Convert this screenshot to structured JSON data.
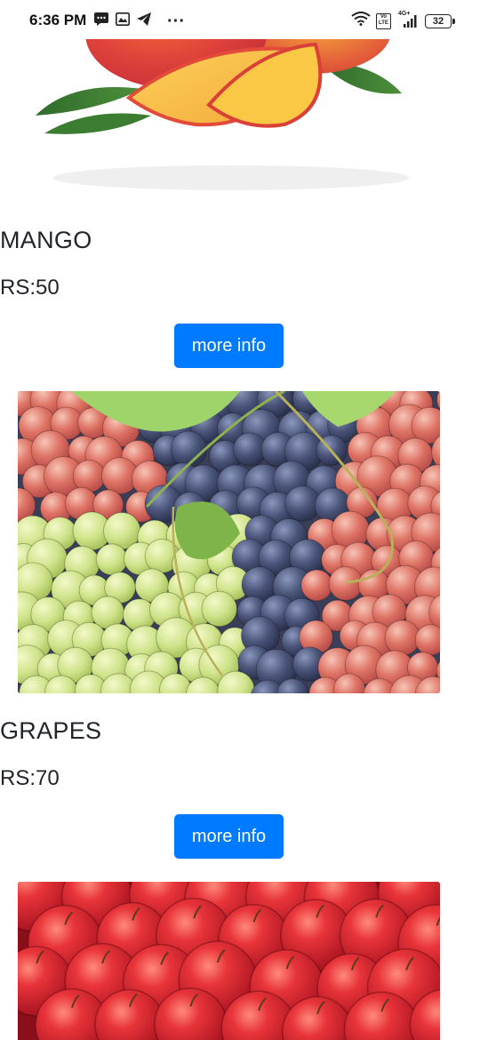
{
  "status_bar": {
    "time": "6:36 PM",
    "left_icons": [
      "chat-bubble-icon",
      "gallery-icon",
      "telegram-icon",
      "more-dots-icon"
    ],
    "more": "···",
    "network": "4G+",
    "lte": "Vo LTE",
    "battery": "32"
  },
  "products": [
    {
      "name": "MANGO",
      "price": "RS:50",
      "button": "more info"
    },
    {
      "name": "GRAPES",
      "price": "RS:70",
      "button": "more info"
    },
    {
      "name": "",
      "price": "",
      "button": ""
    }
  ],
  "colors": {
    "primary_button": "#007bff",
    "text": "#212529"
  }
}
